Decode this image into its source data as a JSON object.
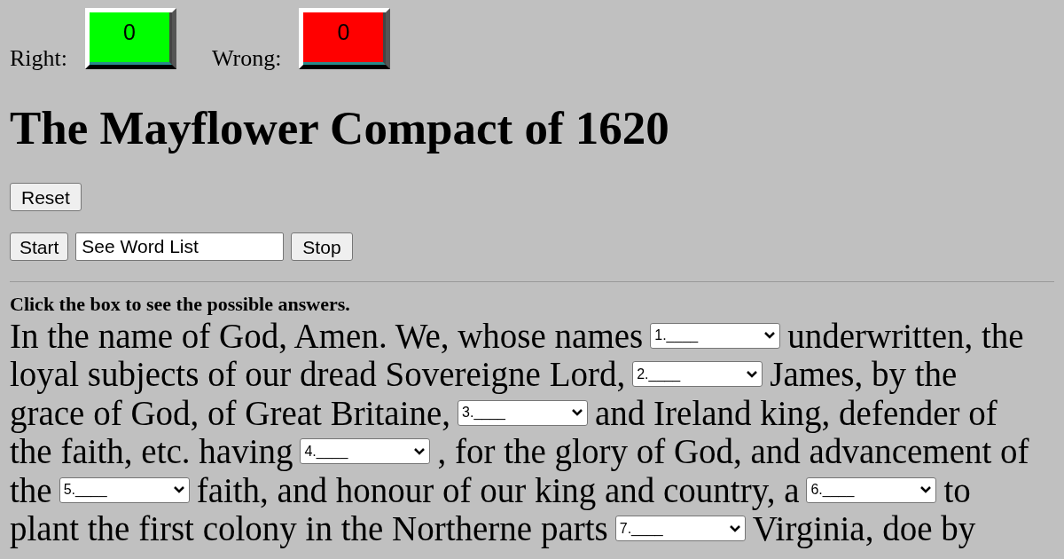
{
  "counters": [
    {
      "label": "Right:",
      "value": "0",
      "color": "#00ff00"
    },
    {
      "label": "Wrong:",
      "value": "0",
      "color": "#ff0000"
    }
  ],
  "title": "The Mayflower Compact of 1620",
  "reset_button": "Reset",
  "start_button": "Start",
  "word_list_field": {
    "value": "See Word List"
  },
  "stop_button": "Stop",
  "instruction": "Click the box to see the possible answers.",
  "passage_lines": [
    [
      {
        "kind": "text",
        "text": "In the name of God, Amen. We, whose names"
      },
      {
        "kind": "blank",
        "value": "1.____"
      },
      {
        "kind": "text",
        "text": "underwritten, the"
      }
    ],
    [
      {
        "kind": "text",
        "text": "loyal subjects of our dread Sovereigne Lord,"
      },
      {
        "kind": "blank",
        "value": "2.____"
      },
      {
        "kind": "text",
        "text": "James, by the"
      }
    ],
    [
      {
        "kind": "text",
        "text": "grace of God, of Great Britaine,"
      },
      {
        "kind": "blank",
        "value": "3.____"
      },
      {
        "kind": "text",
        "text": "and Ireland king, defender of"
      }
    ],
    [
      {
        "kind": "text",
        "text": "the faith, etc. having"
      },
      {
        "kind": "blank",
        "value": "4.____"
      },
      {
        "kind": "text",
        "text": ", for the glory of God, and advancement of"
      }
    ],
    [
      {
        "kind": "text",
        "text": "the"
      },
      {
        "kind": "blank",
        "value": "5.____"
      },
      {
        "kind": "text",
        "text": "faith, and honour of our king and country, a"
      },
      {
        "kind": "blank",
        "value": "6.____"
      },
      {
        "kind": "text",
        "text": "to"
      }
    ],
    [
      {
        "kind": "text",
        "text": "plant the first colony in the Northerne parts"
      },
      {
        "kind": "blank",
        "value": "7.____"
      },
      {
        "kind": "text",
        "text": "Virginia, doe by"
      }
    ]
  ]
}
